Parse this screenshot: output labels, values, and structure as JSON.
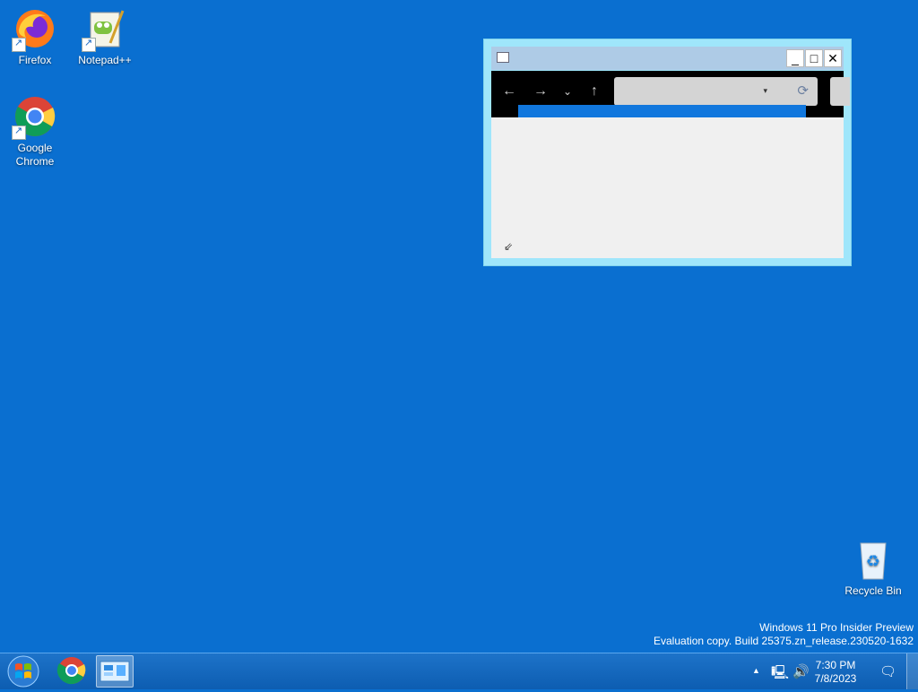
{
  "desktop": {
    "icons": {
      "firefox": "Firefox",
      "notepadpp": "Notepad++",
      "chrome": "Google\nChrome",
      "recycle_bin": "Recycle Bin"
    },
    "watermark": {
      "line1": "Windows 11 Pro Insider Preview",
      "line2": "Evaluation copy. Build 25375.zn_release.230520-1632"
    }
  },
  "window": {
    "controls": {
      "minimize": "_",
      "maximize": "□",
      "close": "✕"
    },
    "nav": {
      "back": "←",
      "forward": "→",
      "recent": "⌄",
      "up": "↑"
    },
    "address": {
      "value": "",
      "dropdown": "▾",
      "refresh": "⟳"
    }
  },
  "taskbar": {
    "clock_time": "7:30 PM",
    "clock_date": "7/8/2023",
    "tray": {
      "chevron": "▲",
      "network": "🖳",
      "volume": "🔊",
      "notifications": "🗨"
    }
  },
  "colors": {
    "desktop": "#0a6fd0",
    "window_frame": "#9fe6fb",
    "taskbar": "#1565c0"
  }
}
